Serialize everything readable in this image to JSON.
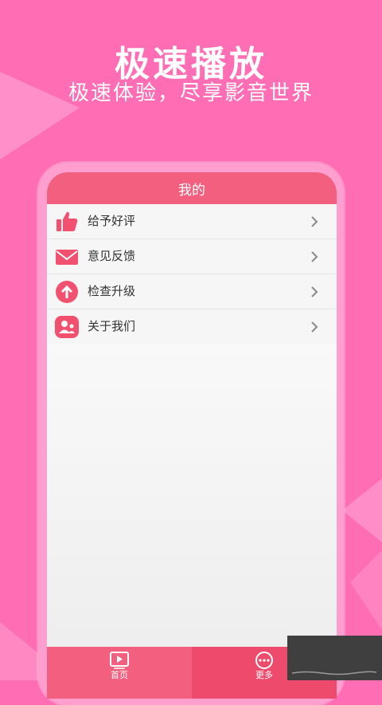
{
  "promo": {
    "title": "极速播放",
    "subtitle": "极速体验，尽享影音世界"
  },
  "screen": {
    "header_title": "我的",
    "menu_items": [
      {
        "label": "给予好评",
        "icon": "thumbs-up-icon"
      },
      {
        "label": "意见反馈",
        "icon": "mail-icon"
      },
      {
        "label": "检查升级",
        "icon": "upgrade-arrow-icon"
      },
      {
        "label": "关于我们",
        "icon": "users-icon"
      }
    ],
    "tabs": [
      {
        "label": "首页",
        "icon": "play-icon"
      },
      {
        "label": "更多",
        "icon": "more-icon"
      }
    ]
  },
  "colors": {
    "background": "#ff6eb4",
    "accent": "#f25f7f",
    "accent_dark": "#ee4a6c",
    "phone_frame": "#ff9fd0",
    "icon_red": "#f2506f"
  }
}
